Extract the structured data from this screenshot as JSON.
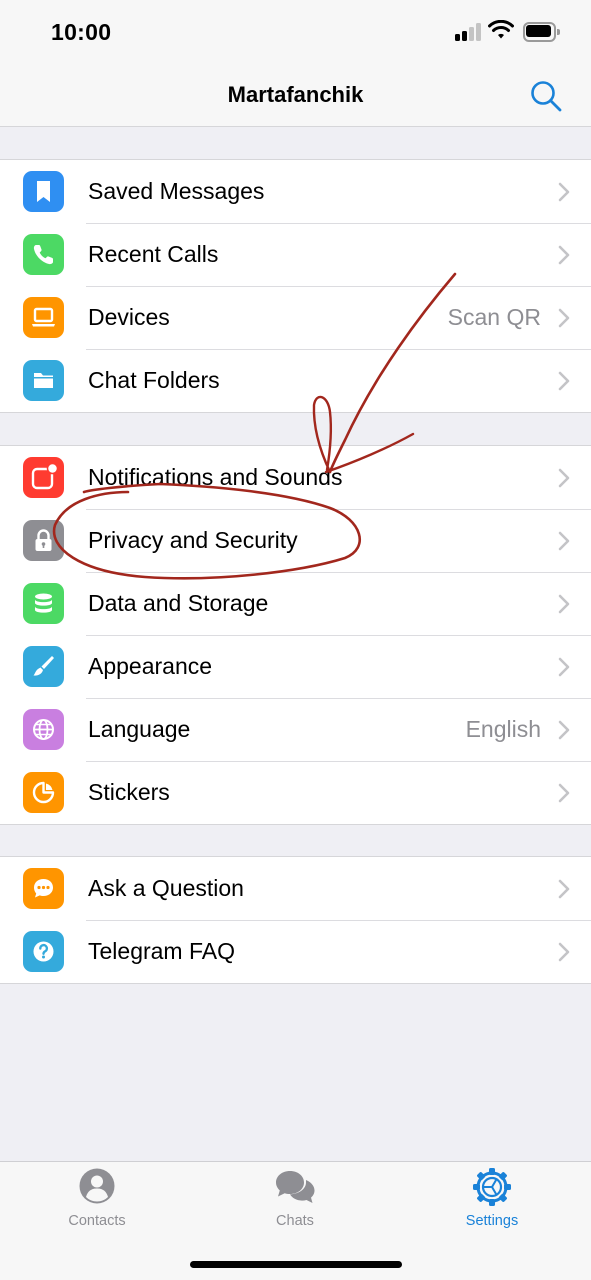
{
  "status_bar": {
    "time": "10:00"
  },
  "header": {
    "title": "Martafanchik",
    "search_icon": "search-icon"
  },
  "groups": [
    {
      "items": [
        {
          "label": "Saved Messages",
          "value": "",
          "icon": "bookmark-icon",
          "color": "#2f8ff2"
        },
        {
          "label": "Recent Calls",
          "value": "",
          "icon": "phone-icon",
          "color": "#4cd964"
        },
        {
          "label": "Devices",
          "value": "Scan QR",
          "icon": "laptop-icon",
          "color": "#ff9500"
        },
        {
          "label": "Chat Folders",
          "value": "",
          "icon": "folder-icon",
          "color": "#34aadc"
        }
      ]
    },
    {
      "items": [
        {
          "label": "Notifications and Sounds",
          "value": "",
          "icon": "notification-badge-icon",
          "color": "#ff3b30"
        },
        {
          "label": "Privacy and Security",
          "value": "",
          "icon": "lock-icon",
          "color": "#8e8e93"
        },
        {
          "label": "Data and Storage",
          "value": "",
          "icon": "database-icon",
          "color": "#4cd964"
        },
        {
          "label": "Appearance",
          "value": "",
          "icon": "brush-icon",
          "color": "#34aadc"
        },
        {
          "label": "Language",
          "value": "English",
          "icon": "globe-icon",
          "color": "#c97fe0"
        },
        {
          "label": "Stickers",
          "value": "",
          "icon": "sticker-icon",
          "color": "#ff9500"
        }
      ]
    },
    {
      "items": [
        {
          "label": "Ask a Question",
          "value": "",
          "icon": "speech-bubble-icon",
          "color": "#ff9500"
        },
        {
          "label": "Telegram FAQ",
          "value": "",
          "icon": "question-icon",
          "color": "#34aadc"
        }
      ]
    }
  ],
  "tabs": [
    {
      "label": "Contacts",
      "icon": "person-icon",
      "active": false
    },
    {
      "label": "Chats",
      "icon": "chat-bubbles-icon",
      "active": false
    },
    {
      "label": "Settings",
      "icon": "gear-icon",
      "active": true
    }
  ],
  "colors": {
    "accent": "#1a82d8",
    "annotation": "#a2271d"
  }
}
